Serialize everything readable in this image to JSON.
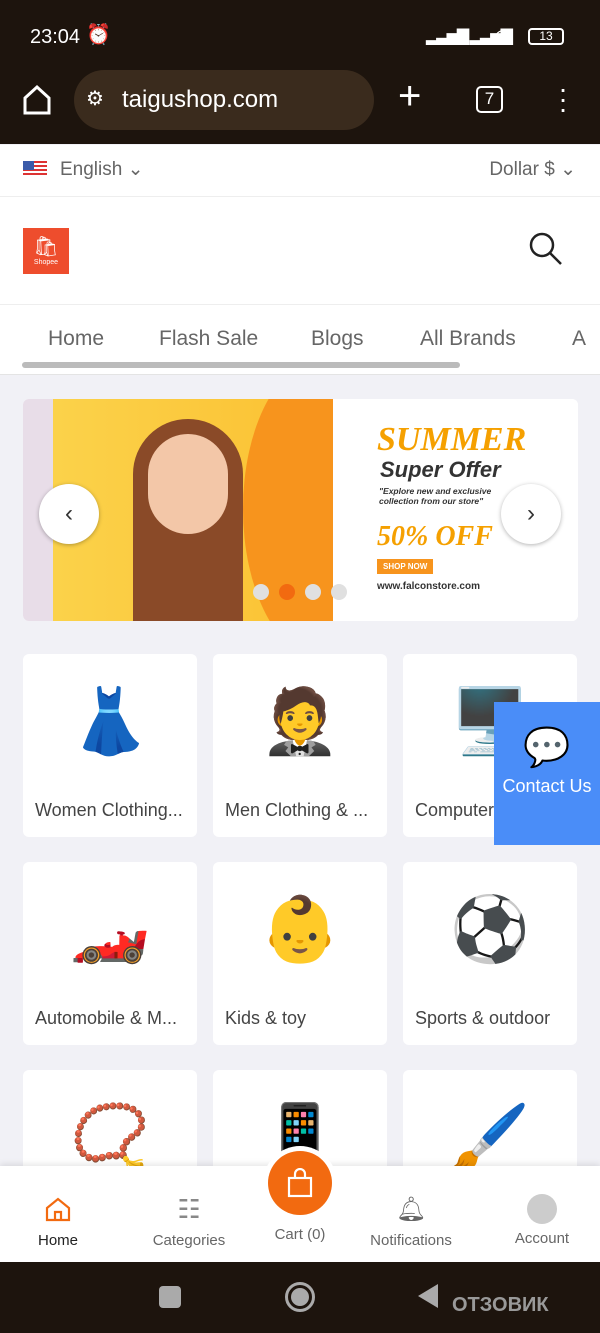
{
  "status": {
    "time": "23:04",
    "battery": "13"
  },
  "browser": {
    "url": "taigushop.com",
    "tabs": "7"
  },
  "lang": {
    "language": "English",
    "currency": "Dollar $"
  },
  "header": {
    "logo_text": "Shopee"
  },
  "nav": {
    "items": [
      "Home",
      "Flash Sale",
      "Blogs",
      "All Brands",
      "A"
    ]
  },
  "banner": {
    "title": "SUMMER",
    "subtitle": "Super Offer",
    "tagline": "\"Explore new and exclusive collection from our store\"",
    "discount": "50% OFF",
    "cta": "SHOP NOW",
    "site": "www.falconstore.com",
    "active_dot": 2,
    "dots": 4
  },
  "categories": [
    {
      "label": "Women Clothing...",
      "icon": "dress"
    },
    {
      "label": "Men Clothing & ...",
      "icon": "suit"
    },
    {
      "label": "Computer & ...",
      "icon": "computer"
    },
    {
      "label": "Automobile & M...",
      "icon": "car"
    },
    {
      "label": "Kids & toy",
      "icon": "baby"
    },
    {
      "label": "Sports & outdoor",
      "icon": "balls"
    },
    {
      "label": "",
      "icon": "necklace"
    },
    {
      "label": "",
      "icon": "phone"
    },
    {
      "label": "",
      "icon": "brushes"
    }
  ],
  "contact": {
    "label": "Contact Us"
  },
  "bottom_nav": {
    "home": "Home",
    "categories": "Categories",
    "cart": "Cart (0)",
    "notifications": "Notifications",
    "account": "Account"
  },
  "watermark": "ОТЗОВИК",
  "colors": {
    "accent": "#f26a10",
    "contact": "#4a8df8",
    "browser_bg": "#1d140d"
  }
}
